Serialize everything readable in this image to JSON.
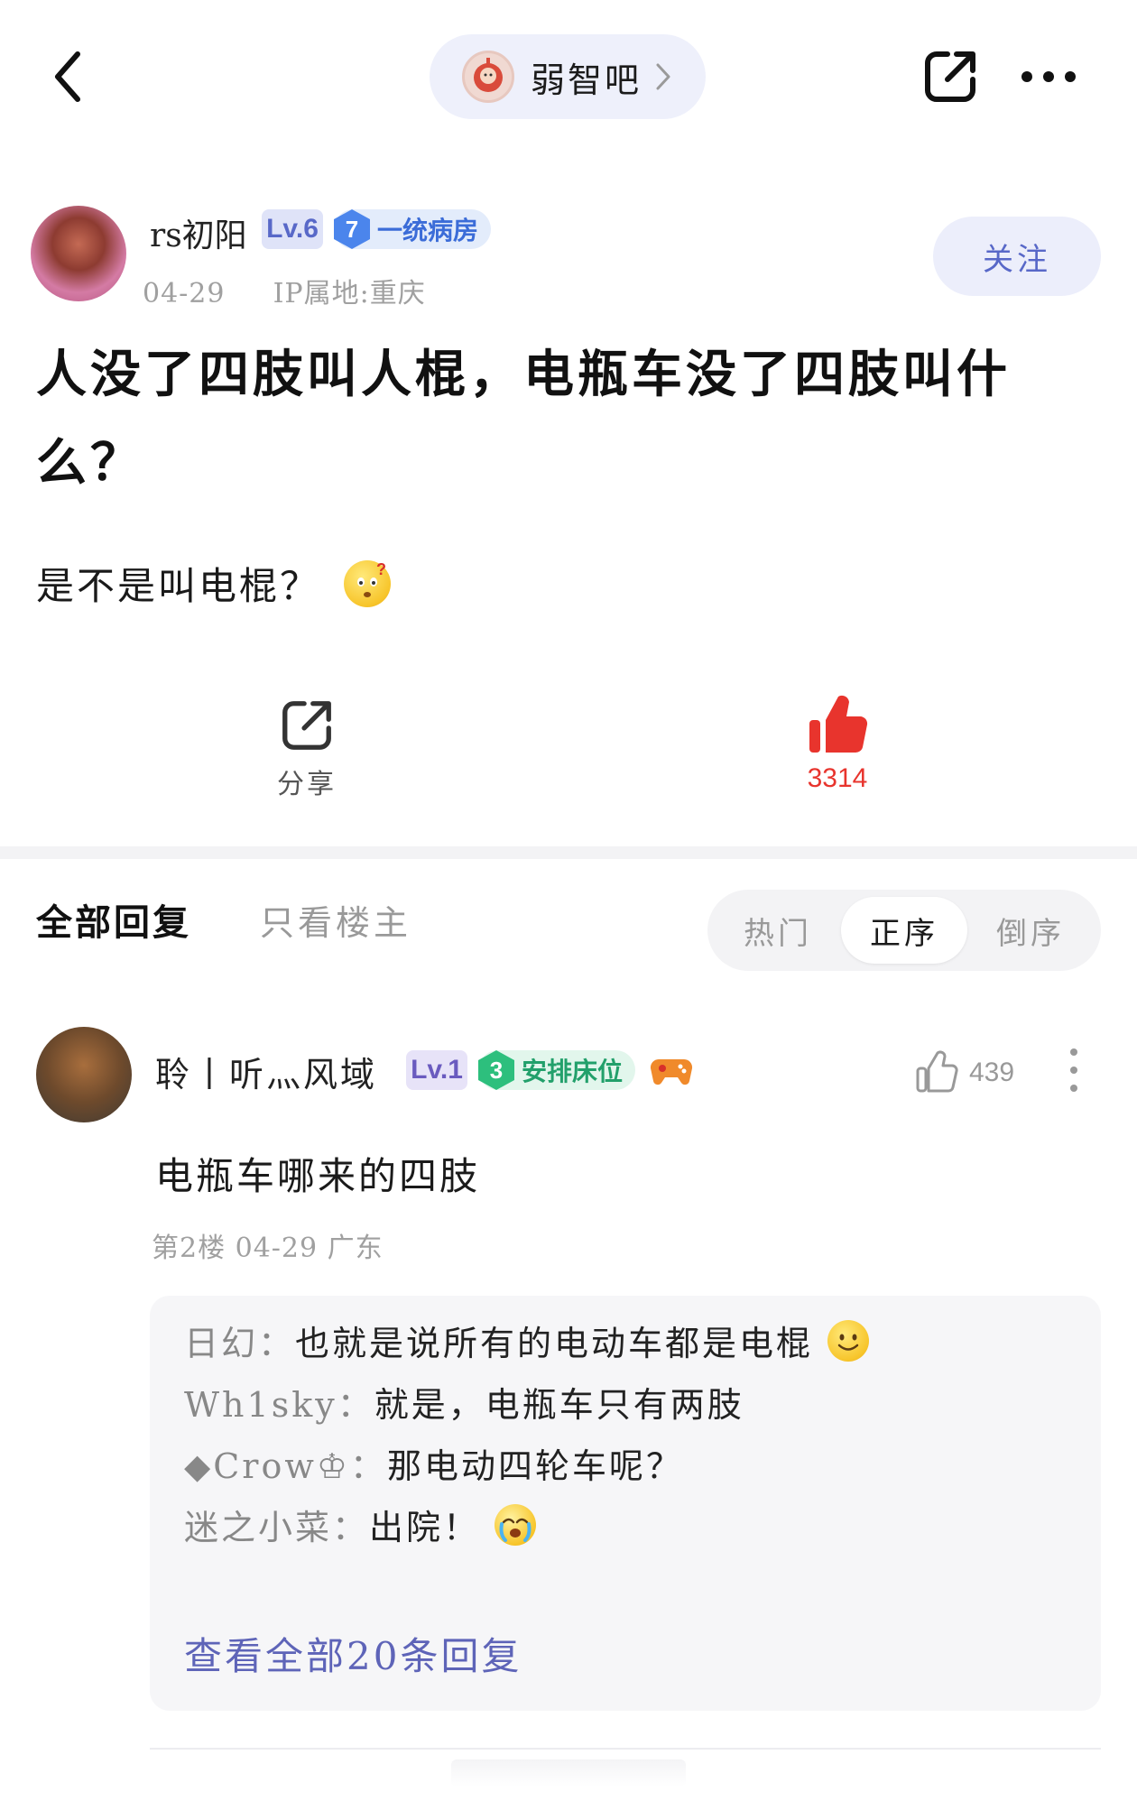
{
  "forum": {
    "name": "弱智吧"
  },
  "post": {
    "author": {
      "name": "rs初阳",
      "level": "Lv.6",
      "room_number": "7",
      "room_name": "一统病房"
    },
    "date": "04-29",
    "ip_location": "IP属地:重庆",
    "follow_label": "关注",
    "title": "人没了四肢叫人棍，电瓶车没了四肢叫什么？",
    "body": "是不是叫电棍？",
    "share_label": "分享",
    "like_count": "3314"
  },
  "tabs": {
    "all": "全部回复",
    "owner_only": "只看楼主",
    "sort": {
      "hot": "热门",
      "asc": "正序",
      "desc": "倒序",
      "selected": "正序"
    }
  },
  "comment": {
    "author": "聆丨听灬风域",
    "level": "Lv.1",
    "room_number": "3",
    "room_name": "安排床位",
    "like_count": "439",
    "text": "电瓶车哪来的四肢",
    "meta": "第2楼  04-29  广东",
    "replies": [
      {
        "user": "日幻：",
        "text": "也就是说所有的电动车都是电棍",
        "emoji": "smile"
      },
      {
        "user": "Wh1sky：",
        "text": "就是，电瓶车只有两肢",
        "emoji": ""
      },
      {
        "user": "◆Crow♔：",
        "text": "那电动四轮车呢？",
        "emoji": ""
      },
      {
        "user": "迷之小菜：",
        "text": "出院！",
        "emoji": "cry"
      }
    ],
    "view_all": "查看全部20条回复"
  },
  "colors": {
    "accent": "#5868c8",
    "like_red": "#e8342d",
    "badge_blue": "#4b85ec",
    "badge_green": "#2dbf7d"
  }
}
